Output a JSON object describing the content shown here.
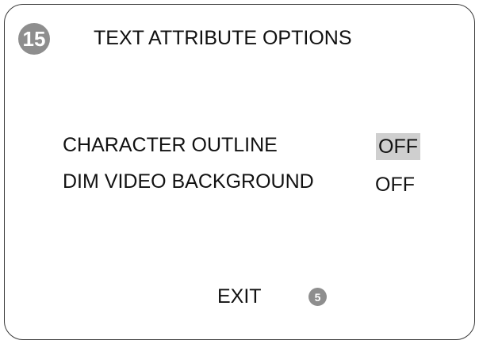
{
  "menu": {
    "number": "15",
    "title": "TEXT ATTRIBUTE OPTIONS",
    "items": [
      {
        "label": "CHARACTER OUTLINE",
        "value": "OFF",
        "selected": true
      },
      {
        "label": "DIM VIDEO BACKGROUND",
        "value": "OFF",
        "selected": false
      }
    ],
    "exit": {
      "label": "EXIT",
      "key_number": "5"
    }
  },
  "colors": {
    "badge": "#8e8e8e",
    "selection_highlight": "#cfcfcf",
    "border": "#3a3a3a",
    "text": "#111111"
  }
}
